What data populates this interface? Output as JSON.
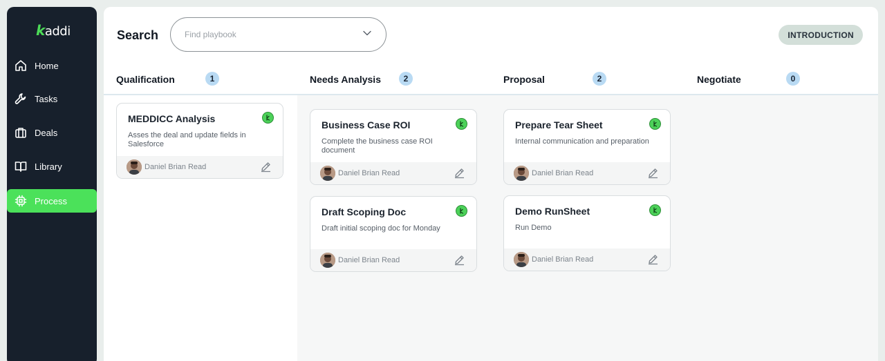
{
  "app": {
    "logo_accent": "k",
    "logo_rest": "addi"
  },
  "sidebar": {
    "items": [
      {
        "label": "Home",
        "icon": "home-icon"
      },
      {
        "label": "Tasks",
        "icon": "wrench-icon"
      },
      {
        "label": "Deals",
        "icon": "briefcase-icon"
      },
      {
        "label": "Library",
        "icon": "book-icon"
      },
      {
        "label": "Process",
        "icon": "chip-icon",
        "active": true
      }
    ]
  },
  "header": {
    "search_label": "Search",
    "search_placeholder": "Find playbook",
    "intro_button": "INTRODUCTION"
  },
  "colors": {
    "accent": "#4be15a",
    "sidebar_bg": "#17202c",
    "count_badge": "#b9daf3"
  },
  "columns": [
    {
      "title": "Qualification",
      "count": "1",
      "cards": [
        {
          "title": "MEDDICC Analysis",
          "desc": "Asses the deal and update fields in Salesforce",
          "assignee": "Daniel Brian Read"
        }
      ]
    },
    {
      "title": "Needs Analysis",
      "count": "2",
      "cards": [
        {
          "title": "Business Case ROI",
          "desc": "Complete the business case ROI document",
          "assignee": "Daniel Brian Read"
        },
        {
          "title": "Draft Scoping Doc",
          "desc": "Draft initial scoping doc for Monday",
          "assignee": "Daniel Brian Read"
        }
      ]
    },
    {
      "title": "Proposal",
      "count": "2",
      "cards": [
        {
          "title": "Prepare Tear Sheet",
          "desc": "Internal communication and preparation",
          "assignee": "Daniel Brian Read"
        },
        {
          "title": "Demo RunSheet",
          "desc": "Run Demo",
          "assignee": "Daniel Brian Read"
        }
      ]
    },
    {
      "title": "Negotiate",
      "count": "0",
      "cards": []
    }
  ]
}
